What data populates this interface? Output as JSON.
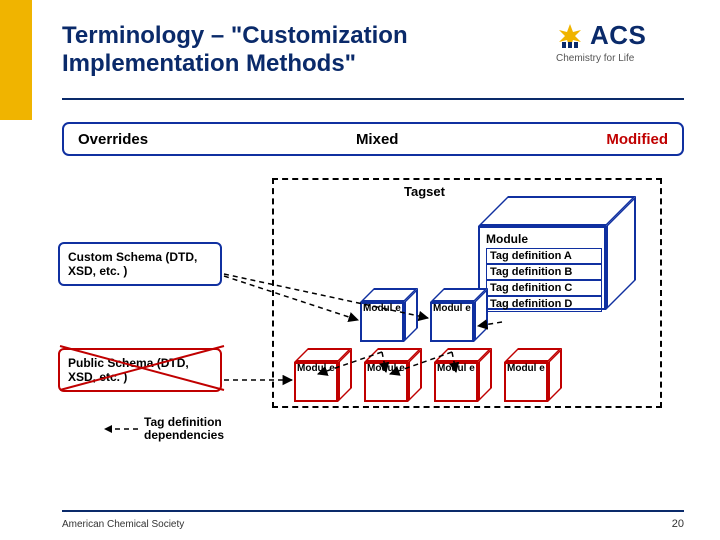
{
  "title": "Terminology – \"Customization Implementation Methods\"",
  "logo": {
    "acronym": "ACS",
    "tagline": "Chemistry for Life"
  },
  "headers": {
    "overrides": "Overrides",
    "mixed": "Mixed",
    "modified": "Modified"
  },
  "tagset_label": "Tagset",
  "module": {
    "label": "Module",
    "defs": [
      "Tag definition A",
      "Tag definition B",
      "Tag definition C",
      "Tag definition D"
    ]
  },
  "small_module_label": "Modul\ne",
  "custom_schema": "Custom Schema (DTD, XSD, etc. )",
  "public_schema": "Public Schema (DTD, XSD, etc. )",
  "legend": "Tag definition\ndependencies",
  "footer": "American Chemical Society",
  "slide_number": "20"
}
